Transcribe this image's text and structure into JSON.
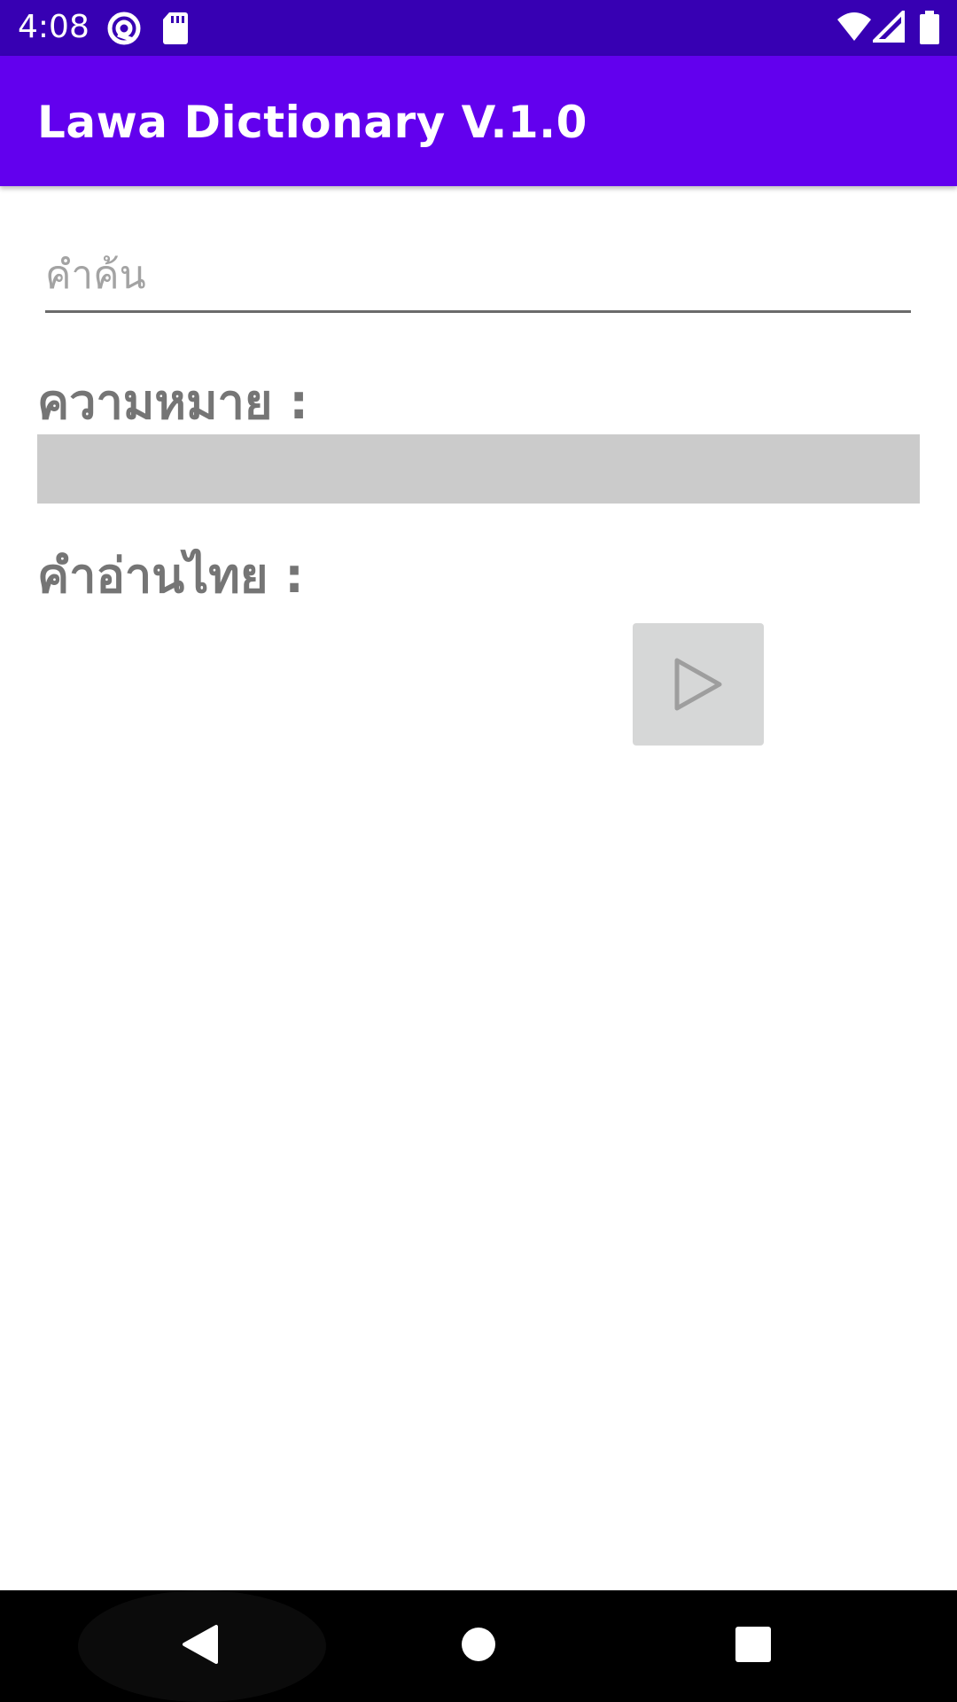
{
  "status_bar": {
    "time": "4:08",
    "icons": [
      "at-sign-icon",
      "sd-card-icon",
      "wifi-icon",
      "signal-icon",
      "battery-icon"
    ]
  },
  "app_bar": {
    "title": "Lawa Dictionary V.1.0"
  },
  "search": {
    "placeholder": "คำค้น",
    "value": ""
  },
  "meaning": {
    "label": "ความหมาย :",
    "value": ""
  },
  "thai_reading": {
    "label": "คำอ่านไทย :",
    "play_icon": "play-icon"
  },
  "nav_bar": {
    "icons": [
      "back-icon",
      "home-icon",
      "recents-icon"
    ]
  },
  "colors": {
    "status_bar": "#3700b3",
    "app_bar": "#6200ee",
    "label_text": "#757575",
    "meaning_box": "#cbcbcb",
    "play_button": "#d6d7d7"
  }
}
